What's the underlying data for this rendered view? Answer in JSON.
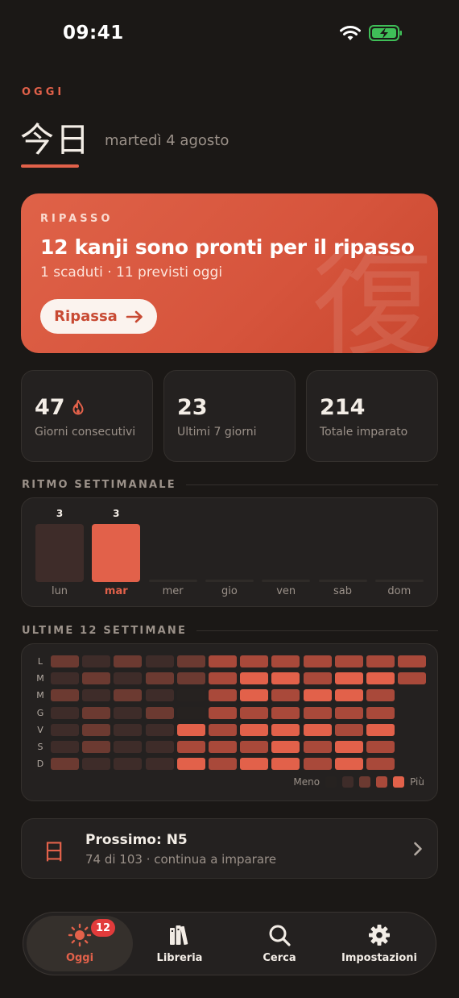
{
  "status_bar": {
    "time": "09:41"
  },
  "header": {
    "eyebrow": "OGGI",
    "kanji_title": "今日",
    "date": "martedì 4 agosto"
  },
  "review_card": {
    "eyebrow": "RIPASSO",
    "title": "12 kanji sono pronti per il ripasso",
    "subtitle": "1 scaduti · 11 previsti oggi",
    "button_label": "Ripassa",
    "watermark_kanji": "復"
  },
  "stats": [
    {
      "value": "47",
      "label": "Giorni consecutivi",
      "icon": "flame-icon"
    },
    {
      "value": "23",
      "label": "Ultimi 7 giorni"
    },
    {
      "value": "214",
      "label": "Totale imparato"
    }
  ],
  "weekly": {
    "title": "RITMO SETTIMANALE",
    "active_day": 1,
    "days": [
      {
        "label": "lun",
        "count": "3",
        "value": 3
      },
      {
        "label": "mar",
        "count": "3",
        "value": 3
      },
      {
        "label": "mer",
        "count": "",
        "value": 0
      },
      {
        "label": "gio",
        "count": "",
        "value": 0
      },
      {
        "label": "ven",
        "count": "",
        "value": 0
      },
      {
        "label": "sab",
        "count": "",
        "value": 0
      },
      {
        "label": "dom",
        "count": "",
        "value": 0
      }
    ]
  },
  "heatmap": {
    "title": "ULTIME 12 SETTIMANE",
    "row_labels": [
      "L",
      "M",
      "M",
      "G",
      "V",
      "S",
      "D"
    ],
    "levels": [
      [
        2,
        1,
        2,
        1,
        2,
        3,
        3,
        3,
        3,
        3,
        3,
        3
      ],
      [
        1,
        2,
        1,
        2,
        2,
        3,
        4,
        4,
        3,
        4,
        4,
        3
      ],
      [
        2,
        1,
        2,
        1,
        0,
        3,
        4,
        3,
        4,
        4,
        3,
        null
      ],
      [
        1,
        2,
        1,
        2,
        0,
        3,
        3,
        3,
        3,
        3,
        3,
        null
      ],
      [
        1,
        2,
        1,
        1,
        4,
        3,
        4,
        4,
        4,
        3,
        4,
        null
      ],
      [
        1,
        2,
        1,
        1,
        3,
        3,
        3,
        4,
        3,
        4,
        3,
        null
      ],
      [
        2,
        1,
        1,
        1,
        4,
        3,
        4,
        4,
        3,
        4,
        3,
        null
      ]
    ],
    "legend_less": "Meno",
    "legend_more": "Più",
    "colors": [
      "#262220",
      "#3e2c29",
      "#6c3a31",
      "#a9493a",
      "#e2614a"
    ]
  },
  "next": {
    "kanji": "日",
    "title": "Prossimo: N5",
    "subtitle": "74 di 103 · continua a imparare"
  },
  "tabs": [
    {
      "label": "Oggi",
      "icon": "sun-icon",
      "badge": "12",
      "active": true
    },
    {
      "label": "Libreria",
      "icon": "books-icon"
    },
    {
      "label": "Cerca",
      "icon": "search-icon"
    },
    {
      "label": "Impostazioni",
      "icon": "gear-icon"
    }
  ],
  "colors": {
    "accent": "#e2614a",
    "background": "#1b1816",
    "card": "#242120",
    "badge": "#e23b3b"
  }
}
